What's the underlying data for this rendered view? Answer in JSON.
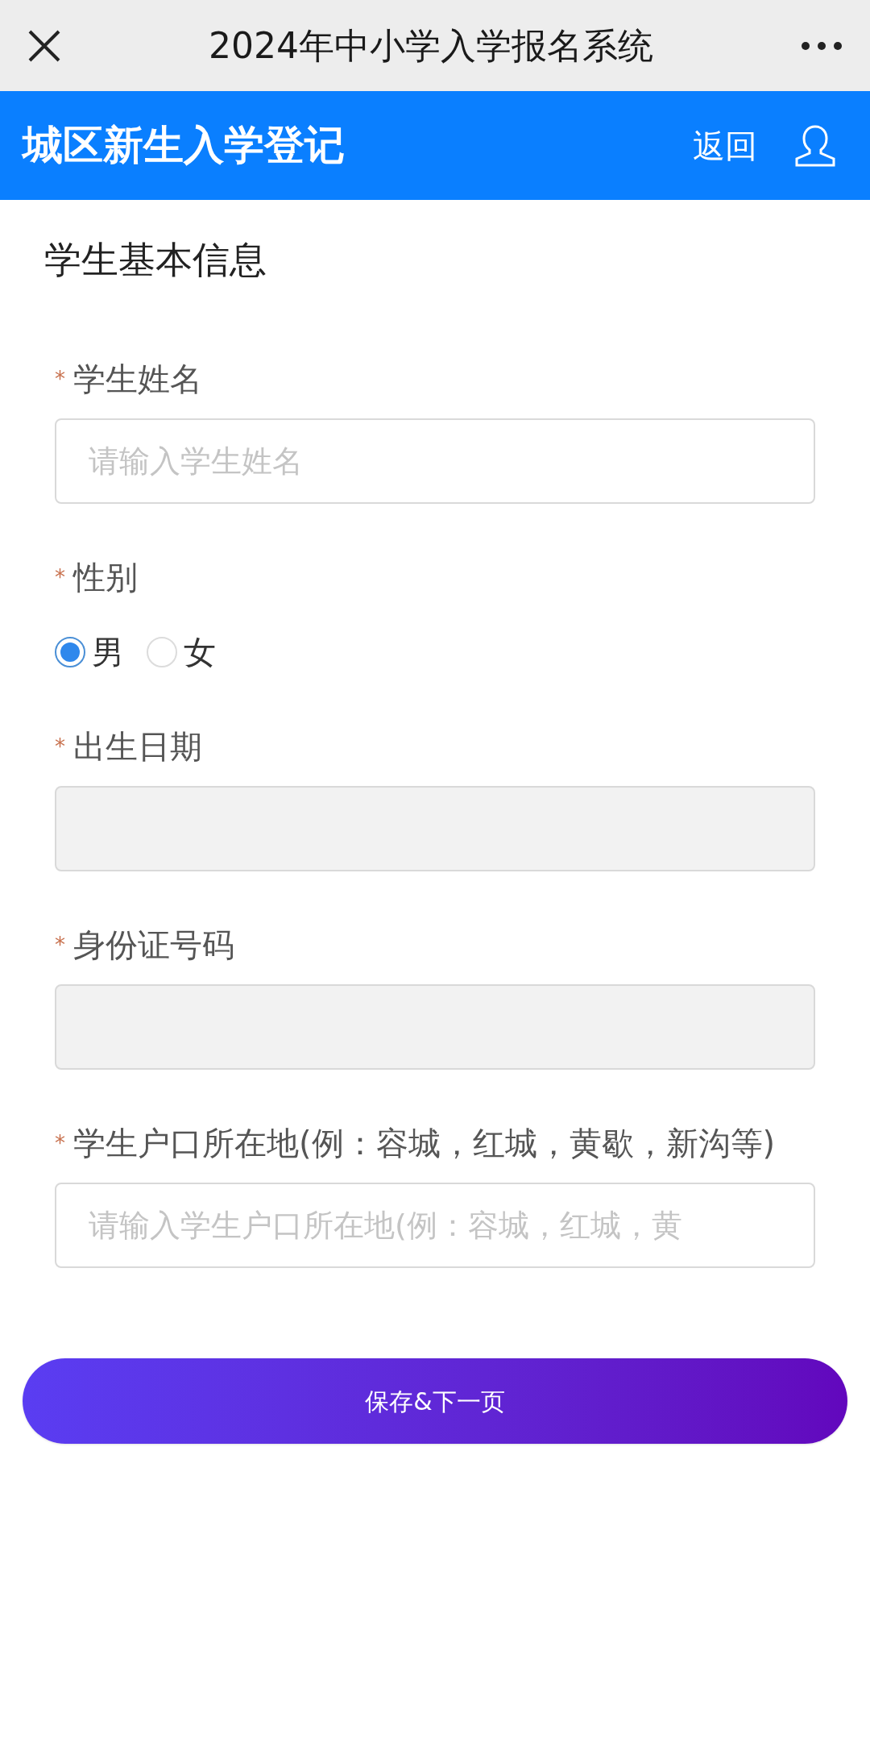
{
  "window": {
    "title": "2024年中小学入学报名系统"
  },
  "header": {
    "title": "城区新生入学登记",
    "back": "返回"
  },
  "section_title": "学生基本信息",
  "fields": [
    {
      "kind": "text",
      "label": "学生姓名",
      "required_mark": "*",
      "placeholder": "请输入学生姓名",
      "disabled": false
    },
    {
      "kind": "radio",
      "label": "性别",
      "required_mark": "*",
      "options": [
        {
          "label": "男",
          "selected": true
        },
        {
          "label": "女",
          "selected": false
        }
      ]
    },
    {
      "kind": "text",
      "label": "出生日期",
      "required_mark": "*",
      "disabled": true
    },
    {
      "kind": "text",
      "label": "身份证号码",
      "required_mark": "*",
      "disabled": true
    },
    {
      "kind": "text",
      "label": "学生户口所在地(例：容城，红城，黄歇，新沟等)",
      "required_mark": "*",
      "placeholder": "请输入学生户口所在地(例：容城，红城，黄",
      "disabled": false
    }
  ],
  "submit_button": "保存&下一页"
}
